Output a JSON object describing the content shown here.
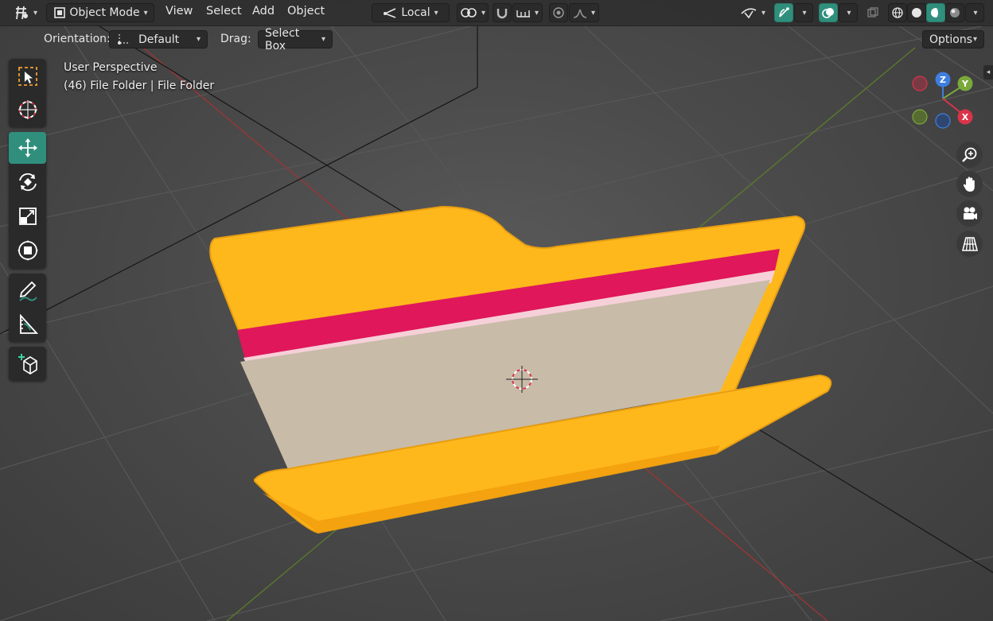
{
  "header": {
    "mode_label": "Object Mode",
    "menus": [
      "View",
      "Select",
      "Add",
      "Object"
    ],
    "transform_orientation": "Local",
    "options_label": "Options"
  },
  "tool_settings": {
    "orientation_label": "Orientation:",
    "orientation_value": "Default",
    "drag_label": "Drag:",
    "drag_value": "Select Box"
  },
  "viewport": {
    "view_name": "User Perspective",
    "object_info": "(46) File Folder | File Folder"
  },
  "toolbar": {
    "tools": [
      "select-box",
      "cursor",
      "move",
      "rotate",
      "scale",
      "transform",
      "annotate",
      "measure",
      "add-cube"
    ],
    "active_tool": "move"
  },
  "gizmo": {
    "axes": [
      "Z",
      "Y",
      "X"
    ]
  },
  "colors": {
    "accent": "#2f8f7c",
    "folder": "#ffb81c",
    "paper": "#c8bba8",
    "divider": "#e0175a",
    "axis_x": "#d9344a",
    "axis_y": "#7aa83a",
    "axis_z": "#3f7ee0"
  }
}
